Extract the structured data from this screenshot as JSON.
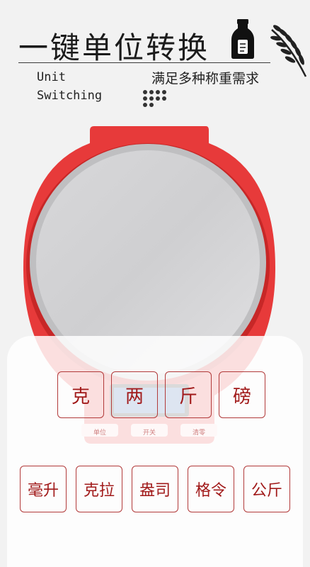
{
  "header": {
    "title": "一键单位转换",
    "subtitle_en": "Unit\nSwitching",
    "subtitle_cn": "满足多种称重需求",
    "bottle_icon": "milk-bottle-icon",
    "decoration_icon": "wheat-icon"
  },
  "scale": {
    "display_buttons": [
      "单位",
      "开关",
      "清零"
    ]
  },
  "units": {
    "row1": [
      "克",
      "两",
      "斤",
      "磅"
    ],
    "row2": [
      "毫升",
      "克拉",
      "盎司",
      "格令",
      "公斤"
    ]
  },
  "colors": {
    "accent": "#a11a1a",
    "scale_red": "#e63a3a",
    "background": "#f2f2f2"
  }
}
